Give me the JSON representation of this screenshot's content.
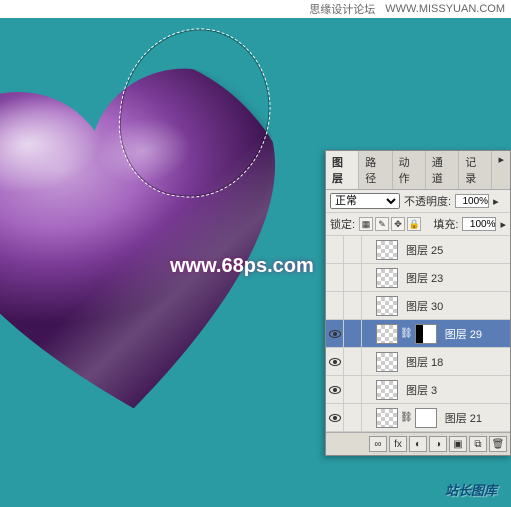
{
  "topbar": {
    "site_title": "思缘设计论坛",
    "site_url": "WWW.MISSYUAN.COM"
  },
  "watermarks": {
    "center": "www.68ps.com",
    "bottom": "站长图库"
  },
  "panel": {
    "tabs": {
      "layers": "图层",
      "paths": "路径",
      "actions": "动作",
      "channels": "通道",
      "history": "记录"
    },
    "blend_mode": "正常",
    "opacity_label": "不透明度:",
    "opacity_value": "100%",
    "lock_label": "锁定:",
    "fill_label": "填充:",
    "fill_value": "100%",
    "layers": [
      {
        "name": "图层 25",
        "visible": false,
        "selected": false,
        "mask": "none",
        "indent": 1
      },
      {
        "name": "图层 23",
        "visible": false,
        "selected": false,
        "mask": "none",
        "indent": 1
      },
      {
        "name": "图层 30",
        "visible": false,
        "selected": false,
        "mask": "none",
        "indent": 1
      },
      {
        "name": "图层 29",
        "visible": true,
        "selected": true,
        "mask": "split",
        "indent": 1
      },
      {
        "name": "图层 18",
        "visible": true,
        "selected": false,
        "mask": "none",
        "indent": 1
      },
      {
        "name": "图层 3",
        "visible": true,
        "selected": false,
        "mask": "none",
        "indent": 1
      },
      {
        "name": "图层 21",
        "visible": true,
        "selected": false,
        "mask": "white",
        "indent": 1
      }
    ],
    "footer_icons": [
      "link-icon",
      "fx-icon",
      "mask-icon",
      "adjustment-icon",
      "group-icon",
      "new-layer-icon",
      "trash-icon"
    ]
  }
}
